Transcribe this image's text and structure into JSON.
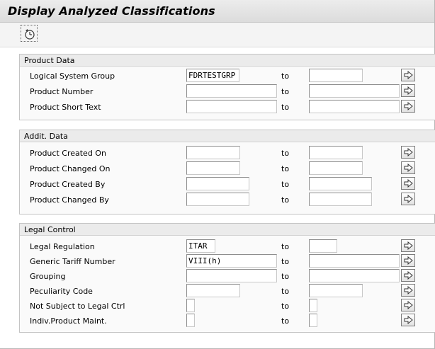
{
  "window": {
    "title": "Display Analyzed Classifications"
  },
  "toolbar": {
    "execute_icon": "execute-clock-icon"
  },
  "groups": [
    {
      "title": "Product Data",
      "rows": [
        {
          "label": "Logical System Group",
          "from": "FDRTESTGRP",
          "to_label": "to",
          "to": ""
        },
        {
          "label": "Product Number",
          "from": "",
          "to_label": "to",
          "to": ""
        },
        {
          "label": "Product Short Text",
          "from": "",
          "to_label": "to",
          "to": ""
        }
      ]
    },
    {
      "title": "Addit. Data",
      "rows": [
        {
          "label": "Product Created On",
          "from": "",
          "to_label": "to",
          "to": ""
        },
        {
          "label": "Product Changed On",
          "from": "",
          "to_label": "to",
          "to": ""
        },
        {
          "label": "Product Created By",
          "from": "",
          "to_label": "to",
          "to": ""
        },
        {
          "label": "Product Changed By",
          "from": "",
          "to_label": "to",
          "to": ""
        }
      ]
    },
    {
      "title": "Legal Control",
      "rows": [
        {
          "label": "Legal Regulation",
          "from": "ITAR",
          "to_label": "to",
          "to": ""
        },
        {
          "label": "Generic Tariff Number",
          "from": "VIII(h)",
          "to_label": "to",
          "to": ""
        },
        {
          "label": "Grouping",
          "from": "",
          "to_label": "to",
          "to": ""
        },
        {
          "label": "Peculiarity Code",
          "from": "",
          "to_label": "to",
          "to": ""
        },
        {
          "label": "Not Subject to Legal Ctrl",
          "from": "",
          "to_label": "to",
          "to": ""
        },
        {
          "label": "Indiv.Product Maint.",
          "from": "",
          "to_label": "to",
          "to": ""
        }
      ]
    }
  ],
  "icons": {
    "multiple_selection": "arrow-right-icon"
  }
}
